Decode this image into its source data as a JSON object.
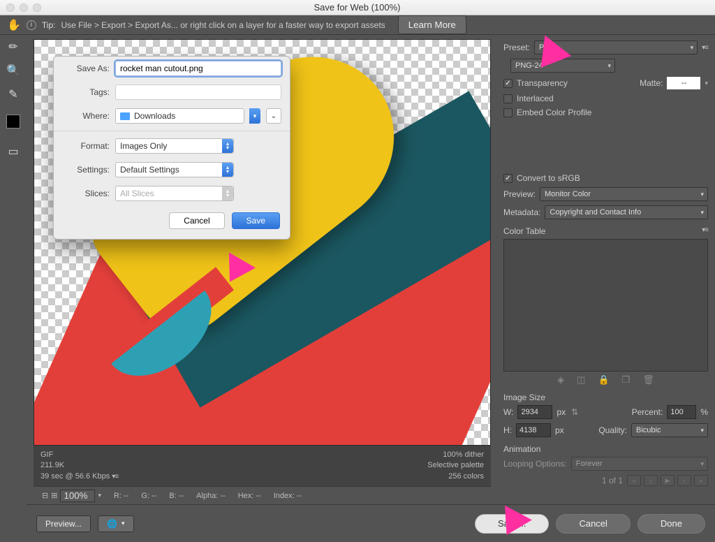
{
  "window": {
    "title": "Save for Web (100%)"
  },
  "tip": {
    "label": "Tip:",
    "text": "Use File > Export > Export As...  or right click on a layer for a faster way to export assets",
    "learn": "Learn More"
  },
  "sheet": {
    "saveAsLabel": "Save As:",
    "saveAsValue": "rocket man cutout.png",
    "tagsLabel": "Tags:",
    "tagsValue": "",
    "whereLabel": "Where:",
    "whereValue": "Downloads",
    "formatLabel": "Format:",
    "formatValue": "Images Only",
    "settingsLabel": "Settings:",
    "settingsValue": "Default Settings",
    "slicesLabel": "Slices:",
    "slicesValue": "All Slices",
    "cancel": "Cancel",
    "save": "Save"
  },
  "imginfo": {
    "line1": "GIF",
    "line2": "211.9K",
    "line3": "39 sec @ 56.6 Kbps",
    "r1": "100% dither",
    "r2": "Selective palette",
    "r3": "256 colors"
  },
  "readout": {
    "zoom": "100%",
    "r": "R: --",
    "g": "G: --",
    "b": "B: --",
    "alpha": "Alpha: --",
    "hex": "Hex: --",
    "index": "Index: --"
  },
  "side": {
    "presetLabel": "Preset:",
    "presetValue": "PNG",
    "format": "PNG-24",
    "transparency": "Transparency",
    "matteLabel": "Matte:",
    "matteValue": "--",
    "interlaced": "Interlaced",
    "embed": "Embed Color Profile",
    "convert": "Convert to sRGB",
    "previewLabel": "Preview:",
    "previewValue": "Monitor Color",
    "metadataLabel": "Metadata:",
    "metadataValue": "Copyright and Contact Info",
    "colorTable": "Color Table",
    "imageSize": "Image Size",
    "wLabel": "W:",
    "wValue": "2934",
    "hLabel": "H:",
    "hValue": "4138",
    "px": "px",
    "percentLabel": "Percent:",
    "percentValue": "100",
    "percentUnit": "%",
    "qualityLabel": "Quality:",
    "qualityValue": "Bicubic",
    "animation": "Animation",
    "loopLabel": "Looping Options:",
    "loopValue": "Forever",
    "frame": "1 of 1"
  },
  "bottom": {
    "preview": "Preview...",
    "save": "Save...",
    "cancel": "Cancel",
    "done": "Done"
  }
}
